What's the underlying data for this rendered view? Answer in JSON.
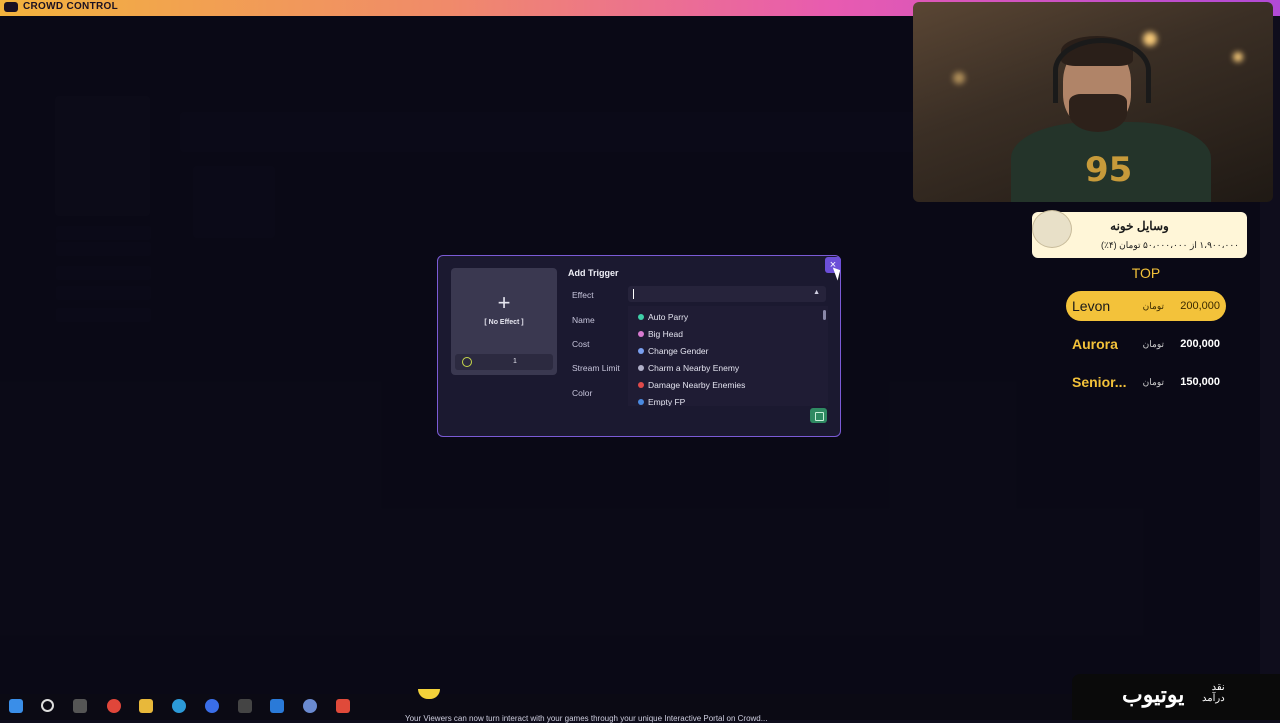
{
  "brand": "CROWD CONTROL",
  "modal": {
    "title": "Add Trigger",
    "close_label": "×",
    "preview": {
      "plus": "+",
      "no_effect": "[ No Effect ]",
      "count": "1"
    },
    "fields": [
      "Effect",
      "Name",
      "Cost",
      "Stream Limit",
      "Color"
    ],
    "effect_options": [
      {
        "label": "Auto Parry",
        "icon": "parry-icon",
        "color": "#3fd0a8"
      },
      {
        "label": "Big Head",
        "icon": "head-icon",
        "color": "#d87ad0"
      },
      {
        "label": "Change Gender",
        "icon": "gender-icon",
        "color": "#7aa0f0"
      },
      {
        "label": "Charm a Nearby Enemy",
        "icon": "charm-icon",
        "color": "#b0b0c8"
      },
      {
        "label": "Damage Nearby Enemies",
        "icon": "damage-icon",
        "color": "#e04a4a"
      },
      {
        "label": "Empty FP",
        "icon": "fp-icon",
        "color": "#4a8ae0"
      }
    ]
  },
  "goal": {
    "title": "وسایل خونه",
    "progress": "۱،۹۰۰،۰۰۰ از ۵۰،۰۰۰،۰۰۰ تومان (۴٪)"
  },
  "leaderboard": {
    "title": "TOP",
    "unit": "تومان",
    "entries": [
      {
        "name": "Levon",
        "amount": "200,000"
      },
      {
        "name": "Aurora",
        "amount": "200,000"
      },
      {
        "name": "Senior...",
        "amount": "150,000"
      }
    ]
  },
  "youtube": {
    "big": "یوتیوب",
    "small_1": "درآمد",
    "small_2": "نقد"
  },
  "ticker": "Your Viewers can now turn interact with your games through your unique Interactive Portal on Crowd..."
}
